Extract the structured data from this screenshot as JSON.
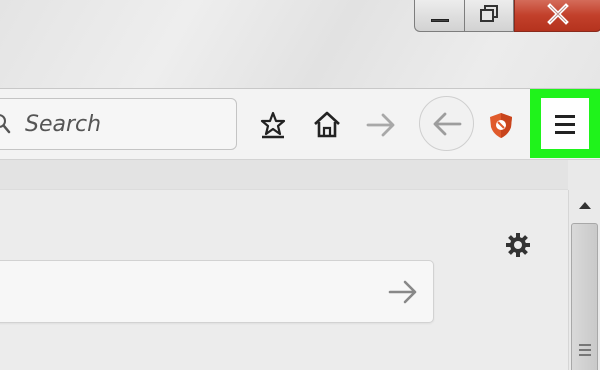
{
  "titlebar": {
    "minimize_icon": "minimize-icon",
    "restore_icon": "restore-icon",
    "close_icon": "close-x-icon"
  },
  "toolbar": {
    "search": {
      "placeholder": "Search",
      "value": ""
    },
    "icons": [
      "bookmark-star-icon",
      "home-icon",
      "forward-arrow-icon",
      "back-arrow-icon",
      "adblock-shield-icon",
      "hamburger-menu-icon"
    ],
    "menu_highlight_color": "#1ff31b"
  },
  "content": {
    "settings_icon": "gear-icon",
    "search": {
      "placeholder": "",
      "value": ""
    },
    "go_icon": "arrow-right-icon"
  },
  "colors": {
    "close_red": "#c2402b",
    "highlight_green": "#1ff31b"
  }
}
